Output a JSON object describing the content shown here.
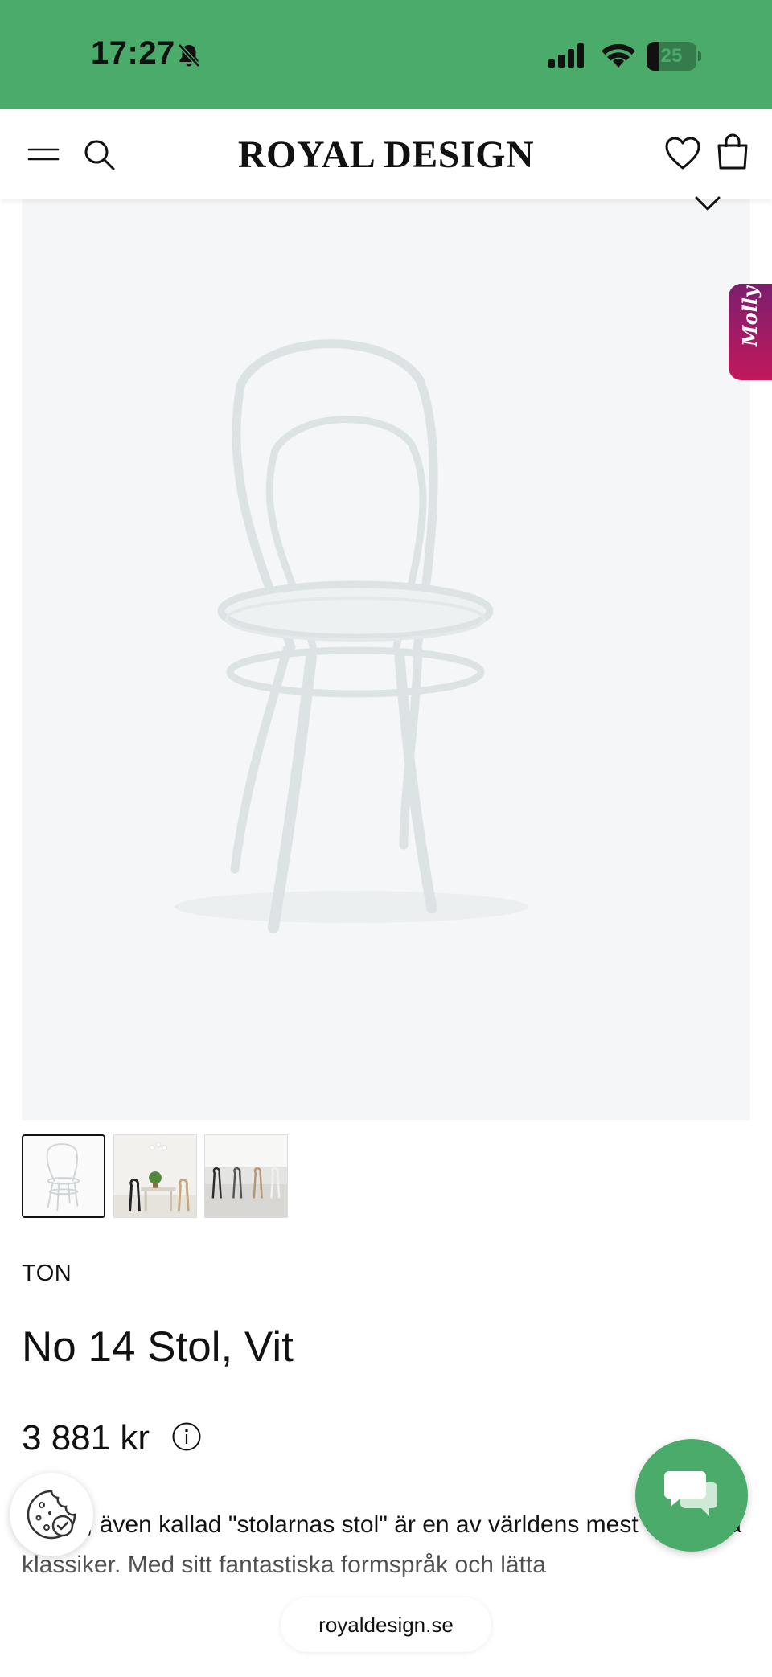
{
  "status_bar": {
    "time": "17:27",
    "battery_level": "25",
    "icons": [
      "bell-slash-icon",
      "signal-icon",
      "wifi-icon",
      "battery-icon"
    ]
  },
  "header": {
    "logo": "ROYAL DESIGN",
    "icons": [
      "menu-icon",
      "search-icon",
      "heart-icon",
      "bag-icon"
    ]
  },
  "gallery": {
    "thumbnails": [
      "thumbnail-chair-white",
      "thumbnail-dining-room",
      "thumbnail-chairs-room"
    ],
    "selected_index": 0
  },
  "assistant_tab": {
    "label": "Molly"
  },
  "product": {
    "brand": "TON",
    "title": "No 14 Stol, Vit",
    "price": "3 881 kr",
    "description": "No 14, även kallad \"stolarnas stol\" är en av världens mest omtyckta klassiker. Med sitt fantastiska formspråk och lätta"
  },
  "browser": {
    "url": "royaldesign.se"
  },
  "colors": {
    "status_bar_bg": "#4aab6a",
    "chat_button_bg": "#4aab6a",
    "molly_gradient_start": "#7b1f6e",
    "molly_gradient_end": "#c2185b",
    "product_image_bg": "#f5f6f7"
  }
}
